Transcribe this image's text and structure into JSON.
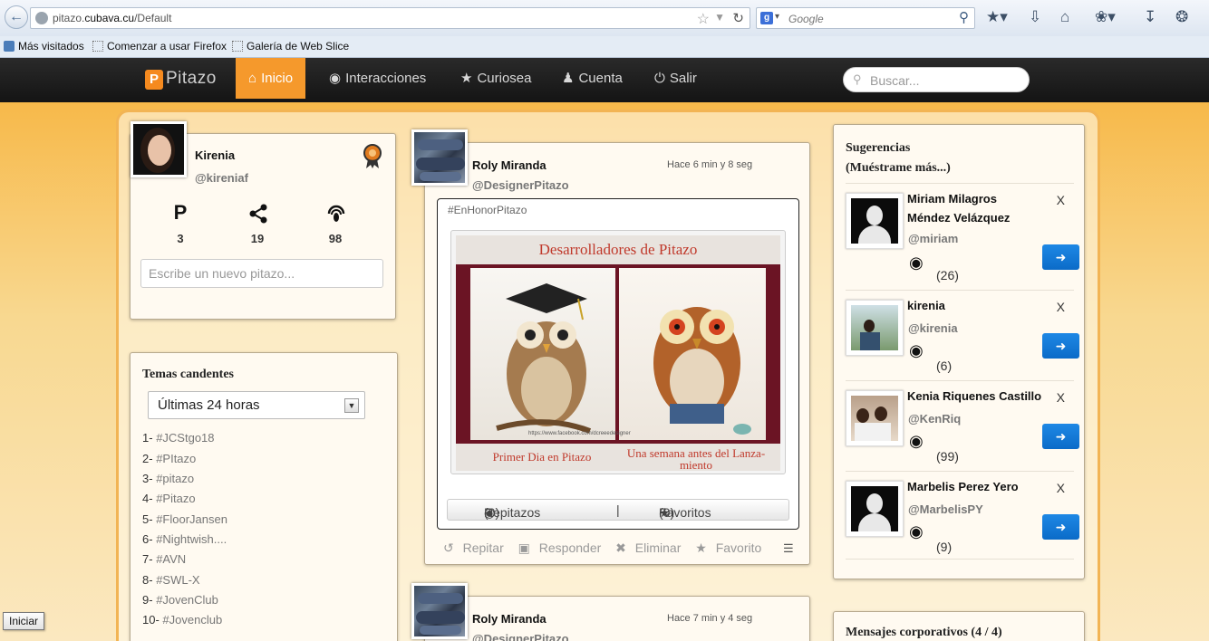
{
  "browser": {
    "url_host": "pitazo.",
    "url_domain": "cubava.cu",
    "url_path": "/Default",
    "search_placeholder": "Google",
    "bookmarks": [
      "Más visitados",
      "Comenzar a usar Firefox",
      "Galería de Web Slice"
    ]
  },
  "navbar": {
    "logo": "Pitazo",
    "items": [
      {
        "label": "Inicio",
        "icon": "home-icon"
      },
      {
        "label": "Interacciones",
        "icon": "eye-icon"
      },
      {
        "label": "Curiosea",
        "icon": "star-icon"
      },
      {
        "label": "Cuenta",
        "icon": "user-icon"
      },
      {
        "label": "Salir",
        "icon": "power-icon"
      }
    ],
    "search_placeholder": "Buscar..."
  },
  "profile": {
    "name": "Kirenia",
    "handle": "@kireniaf",
    "stats": [
      {
        "icon": "pitazo-icon",
        "value": "3"
      },
      {
        "icon": "share-icon",
        "value": "19"
      },
      {
        "icon": "listen-icon",
        "value": "98"
      }
    ],
    "new_post_placeholder": "Escribe un nuevo pitazo..."
  },
  "trending": {
    "title": "Temas candentes",
    "period": "Últimas 24 horas",
    "items": [
      {
        "n": "1-",
        "tag": "#JCStgo18"
      },
      {
        "n": "2-",
        "tag": "#PItazo"
      },
      {
        "n": "3-",
        "tag": "#pitazo"
      },
      {
        "n": "4-",
        "tag": "#Pitazo"
      },
      {
        "n": "5-",
        "tag": "#FloorJansen"
      },
      {
        "n": "6-",
        "tag": "#Nightwish...."
      },
      {
        "n": "7-",
        "tag": "#AVN"
      },
      {
        "n": "8-",
        "tag": "#SWL-X"
      },
      {
        "n": "9-",
        "tag": "#JovenClub"
      },
      {
        "n": "10-",
        "tag": "#Jovenclub"
      }
    ]
  },
  "posts": [
    {
      "author": "Roly Miranda",
      "handle": "@DesignerPitazo",
      "time": "Hace 6 min y 8 seg",
      "hashtag": "#EnHonorPitazo",
      "image": {
        "title": "Desarrolladores de Pitazo",
        "caption_left": "Primer Dia en Pitazo",
        "caption_right_1": "Una semana antes del Lanza-",
        "caption_right_2": "miento",
        "watermark": "https://www.facebook.com/dcreeedesigner"
      },
      "repitazos_label": "Repitazos",
      "repitazos_count": "(0)",
      "separator": "|",
      "favoritos_label": "Favoritos",
      "favoritos_count": "(0)",
      "actions": {
        "repitar": "Repitar",
        "responder": "Responder",
        "eliminar": "Eliminar",
        "favorito": "Favorito"
      }
    },
    {
      "author": "Roly Miranda",
      "handle": "@DesignerPitazo",
      "time": "Hace 7 min y 4 seg"
    }
  ],
  "suggestions": {
    "title_1": "Sugerencias",
    "title_2": "(Muéstrame más...)",
    "items": [
      {
        "name": "Miriam Milagros Méndez Velázquez",
        "handle": "@miriam",
        "count": "(26)",
        "close": "X"
      },
      {
        "name": "kirenia",
        "handle": "@kirenia",
        "count": "(6)",
        "close": "X"
      },
      {
        "name": "Kenia Riquenes Castillo",
        "handle": "@KenRiq",
        "count": "(99)",
        "close": "X"
      },
      {
        "name": "Marbelis Perez Yero",
        "handle": "@MarbelisPY",
        "count": "(9)",
        "close": "X"
      }
    ]
  },
  "corporate": {
    "title": "Mensajes corporativos (4 / 4)"
  },
  "taskbar": {
    "start": "Iniciar"
  },
  "colors": {
    "accent": "#f5992c",
    "navbar": "#1c1c1c",
    "share_button": "#1e88e5"
  }
}
